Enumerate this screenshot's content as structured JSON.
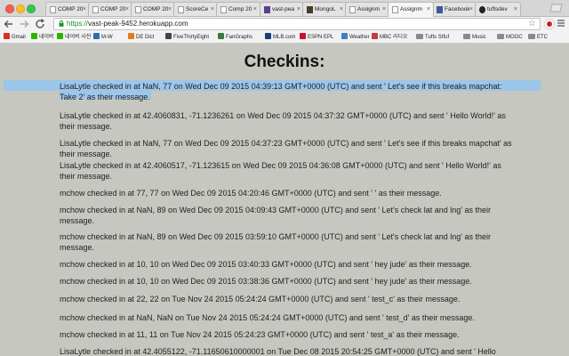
{
  "browser": {
    "tabs": [
      {
        "label": "COMP 20",
        "icon": "document-icon"
      },
      {
        "label": "COMP 20",
        "icon": "document-icon"
      },
      {
        "label": "COMP 20",
        "icon": "document-icon"
      },
      {
        "label": "ScoreCe",
        "icon": "document-icon"
      },
      {
        "label": "Comp 20",
        "icon": "document-icon"
      },
      {
        "label": "vast-pea",
        "icon": "heroku-icon"
      },
      {
        "label": "MongoL",
        "icon": "mongolab-icon"
      },
      {
        "label": "Assignm",
        "icon": "document-icon"
      },
      {
        "label": "Assignm",
        "icon": "document-icon",
        "active": true
      },
      {
        "label": "Facebook",
        "icon": "facebook-icon"
      },
      {
        "label": "tuftsdev",
        "icon": "github-icon"
      }
    ],
    "url": {
      "scheme": "https://",
      "host": "vast-peak-9452.herokuapp.com"
    },
    "bookmarks": [
      {
        "label": "Gmail",
        "icon": "gmail-icon",
        "color": "#d93025"
      },
      {
        "label": "네이버",
        "icon": "naver-icon",
        "color": "#2db400"
      },
      {
        "label": "네이버 사전",
        "icon": "naver-dict-icon",
        "color": "#2db400"
      },
      {
        "label": "M-W",
        "icon": "merriam-webster-icon",
        "color": "#2a6fb0"
      },
      {
        "label": "DE Dict",
        "icon": "dict-icon",
        "color": "#e37b1b"
      },
      {
        "label": "FiveThirtyEight",
        "icon": "fivethirtyeight-icon",
        "color": "#444444"
      },
      {
        "label": "FanGraphs",
        "icon": "fangraphs-icon",
        "color": "#3a7a3a"
      },
      {
        "label": "MLB.com",
        "icon": "mlb-icon",
        "color": "#1a3c7a"
      },
      {
        "label": "ESPN EPL",
        "icon": "espn-icon",
        "color": "#c8102e"
      },
      {
        "label": "Weather",
        "icon": "weather-icon",
        "color": "#3b82c4"
      },
      {
        "label": "MBC 라디오",
        "icon": "mbc-icon",
        "color": "#c33b3b"
      },
      {
        "label": "Tufts Stfuf",
        "icon": "folder-icon",
        "color": "#8a8a8a"
      },
      {
        "label": "Music",
        "icon": "folder-icon",
        "color": "#8a8a8a"
      },
      {
        "label": "MOOC",
        "icon": "folder-icon",
        "color": "#8a8a8a"
      },
      {
        "label": "ETC",
        "icon": "folder-icon",
        "color": "#8a8a8a"
      }
    ]
  },
  "page": {
    "title": "Checkins:",
    "checkins": [
      "LisaLytle checked in at NaN, 77 on Wed Dec 09 2015 04:39:13 GMT+0000 (UTC) and sent ' Let's see if this breaks mapchat: Take 2' as their message.",
      "LisaLytle checked in at 42.4060831, -71.1236261 on Wed Dec 09 2015 04:37:32 GMT+0000 (UTC) and sent ' Hello World!' as their message.",
      "LisaLytle checked in at NaN, 77 on Wed Dec 09 2015 04:37:23 GMT+0000 (UTC) and sent ' Let's see if this breaks mapchat' as their message.",
      "LisaLytle checked in at 42.4060517, -71.123615 on Wed Dec 09 2015 04:36:08 GMT+0000 (UTC) and sent ' Hello World!' as their message.",
      "mchow checked in at 77, 77 on Wed Dec 09 2015 04:20:46 GMT+0000 (UTC) and sent ' ' as their message.",
      "mchow checked in at NaN, 89 on Wed Dec 09 2015 04:09:43 GMT+0000 (UTC) and sent ' Let's check lat and lng' as their message.",
      "mchow checked in at NaN, 89 on Wed Dec 09 2015 03:59:10 GMT+0000 (UTC) and sent ' Let's check lat and lng' as their message.",
      "mchow checked in at 10, 10 on Wed Dec 09 2015 03:40:33 GMT+0000 (UTC) and sent ' hey jude' as their message.",
      "mchow checked in at 10, 10 on Wed Dec 09 2015 03:38:36 GMT+0000 (UTC) and sent ' hey jude' as their message.",
      "mchow checked in at 22, 22 on Tue Nov 24 2015 05:24:24 GMT+0000 (UTC) and sent ' test_c' as their message.",
      "mchow checked in at NaN, NaN on Tue Nov 24 2015 05:24:24 GMT+0000 (UTC) and sent ' test_d' as their message.",
      "mchow checked in at 11, 11 on Tue Nov 24 2015 05:24:23 GMT+0000 (UTC) and sent ' test_a' as their message.",
      "LisaLytle checked in at 42.4055122, -71.11650610000001 on Tue Dec 08 2015 20:54:25 GMT+0000 (UTC) and sent ' Hello"
    ]
  }
}
